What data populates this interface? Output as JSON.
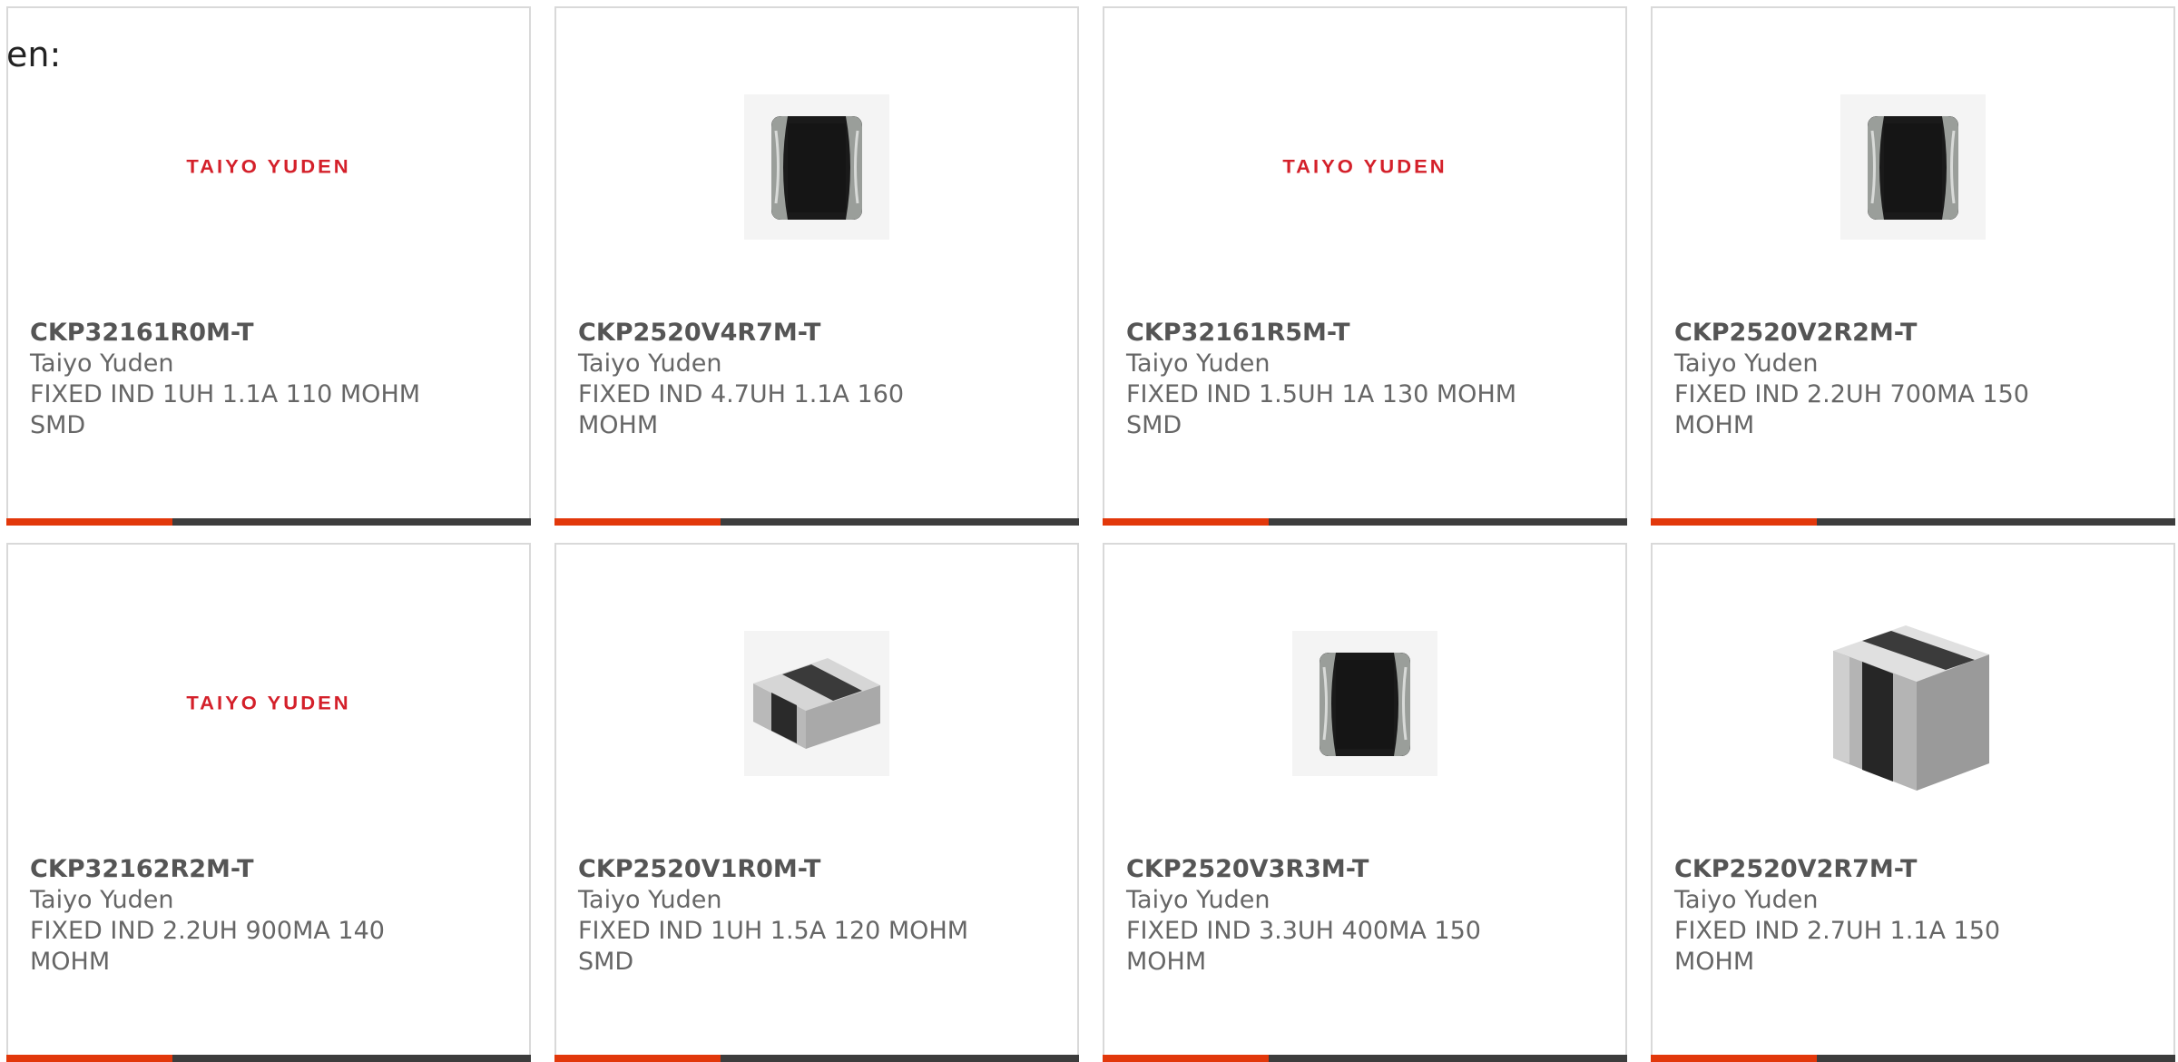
{
  "lead_text": "en:",
  "products": [
    {
      "part_number": "CKP32161R0M-T",
      "manufacturer": "Taiyo Yuden",
      "description": "FIXED IND 1UH 1.1A 110 MOHM SMD",
      "image": "taiyo-yuden-logo"
    },
    {
      "part_number": "CKP2520V4R7M-T",
      "manufacturer": "Taiyo Yuden",
      "description": "FIXED IND 4.7UH 1.1A 160 MOHM",
      "image": "chip-top-view"
    },
    {
      "part_number": "CKP32161R5M-T",
      "manufacturer": "Taiyo Yuden",
      "description": "FIXED IND 1.5UH 1A 130 MOHM SMD",
      "image": "taiyo-yuden-logo"
    },
    {
      "part_number": "CKP2520V2R2M-T",
      "manufacturer": "Taiyo Yuden",
      "description": "FIXED IND 2.2UH 700MA 150 MOHM",
      "image": "chip-top-view"
    },
    {
      "part_number": "CKP32162R2M-T",
      "manufacturer": "Taiyo Yuden",
      "description": "FIXED IND 2.2UH 900MA 140 MOHM",
      "image": "taiyo-yuden-logo"
    },
    {
      "part_number": "CKP2520V1R0M-T",
      "manufacturer": "Taiyo Yuden",
      "description": "FIXED IND 1UH 1.5A 120 MOHM SMD",
      "image": "chip-flat-3d"
    },
    {
      "part_number": "CKP2520V3R3M-T",
      "manufacturer": "Taiyo Yuden",
      "description": "FIXED IND 3.3UH 400MA 150 MOHM",
      "image": "chip-top-view"
    },
    {
      "part_number": "CKP2520V2R7M-T",
      "manufacturer": "Taiyo Yuden",
      "description": "FIXED IND 2.7UH 1.1A 150 MOHM",
      "image": "chip-cube-3d"
    }
  ],
  "logo_text": "TAIYO YUDEN",
  "colors": {
    "accent": "#e2380b",
    "bar": "#3d3d3d",
    "logo": "#d4202a",
    "text": "#666666"
  }
}
